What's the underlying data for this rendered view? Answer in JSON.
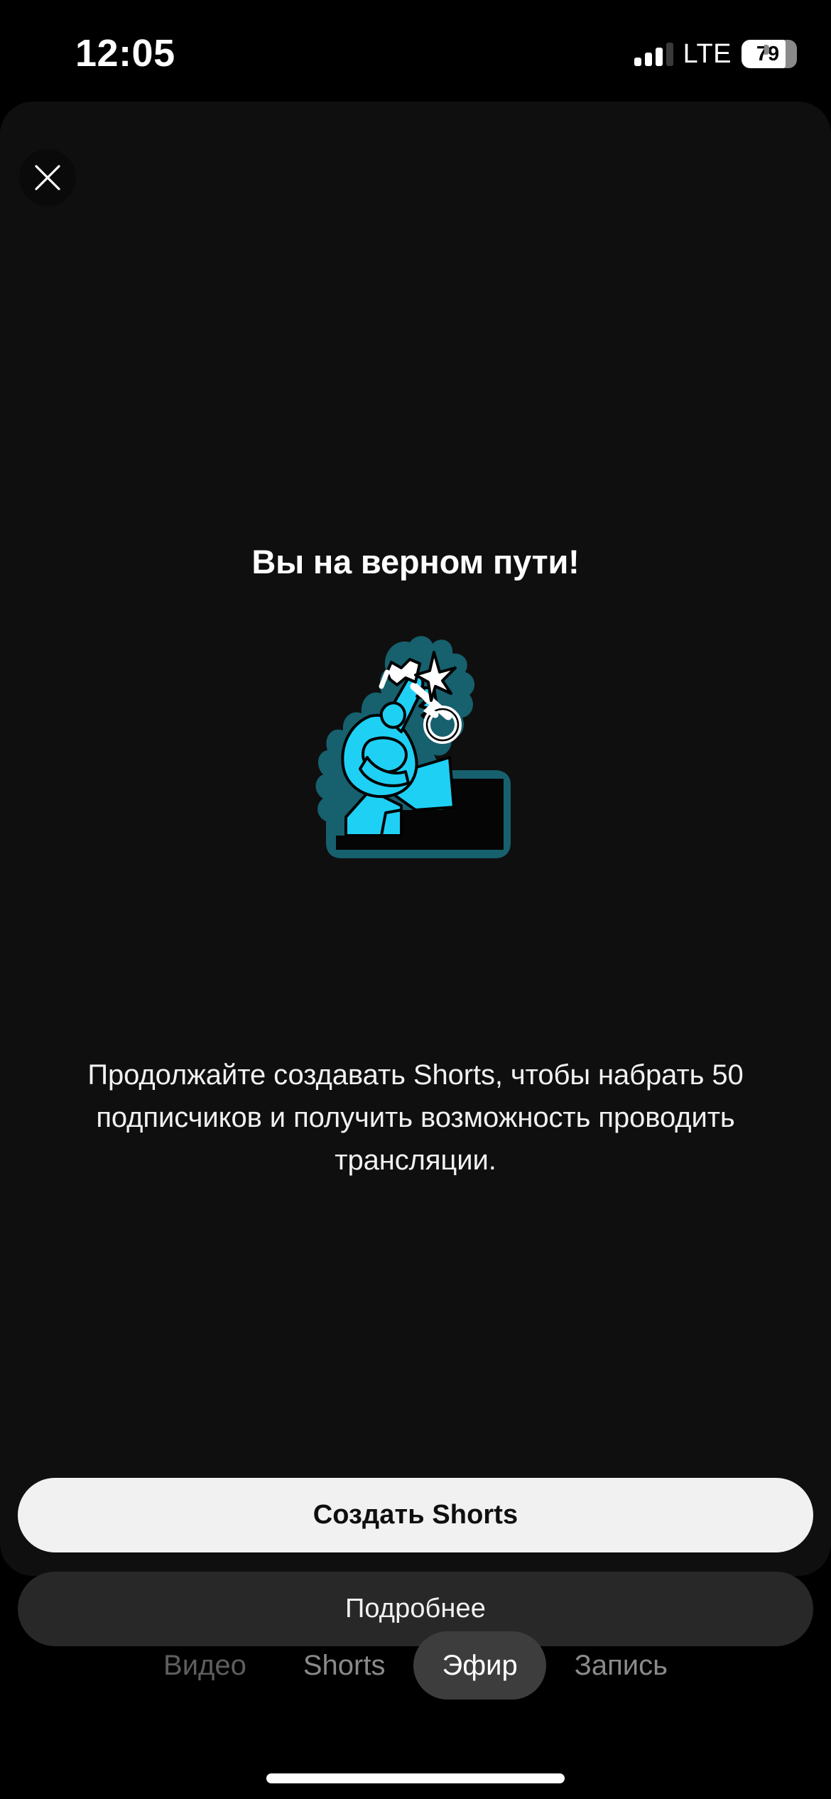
{
  "status_bar": {
    "time": "12:05",
    "network_label": "LTE",
    "battery_level": "79",
    "signal_icon": "signal-bars-icon",
    "battery_icon": "battery-icon"
  },
  "sheet": {
    "close_icon": "close-x-icon",
    "title": "Вы на верном пути!",
    "illustration_name": "person-climbing-stairs-with-key-illustration",
    "body_text": "Продолжайте создавать Shorts, чтобы набрать 50 подписчиков и получить возможность проводить трансляции.",
    "primary_button": "Создать Shorts",
    "secondary_button": "Подробнее"
  },
  "mode_selector": {
    "items": [
      {
        "label": "Видео",
        "state": "dim"
      },
      {
        "label": "Shorts",
        "state": "normal"
      },
      {
        "label": "Эфир",
        "state": "active"
      },
      {
        "label": "Запись",
        "state": "normal"
      }
    ]
  },
  "colors": {
    "sheet_bg": "#0f0f0f",
    "screen_bg": "#000000",
    "primary_button_bg": "#f1f1f1",
    "secondary_button_bg": "#282828",
    "active_pill_bg": "#3d3d3d",
    "illustration_accent": "#1fd0f5",
    "illustration_shadow": "#17606e"
  },
  "home_indicator": "home-indicator-bar"
}
